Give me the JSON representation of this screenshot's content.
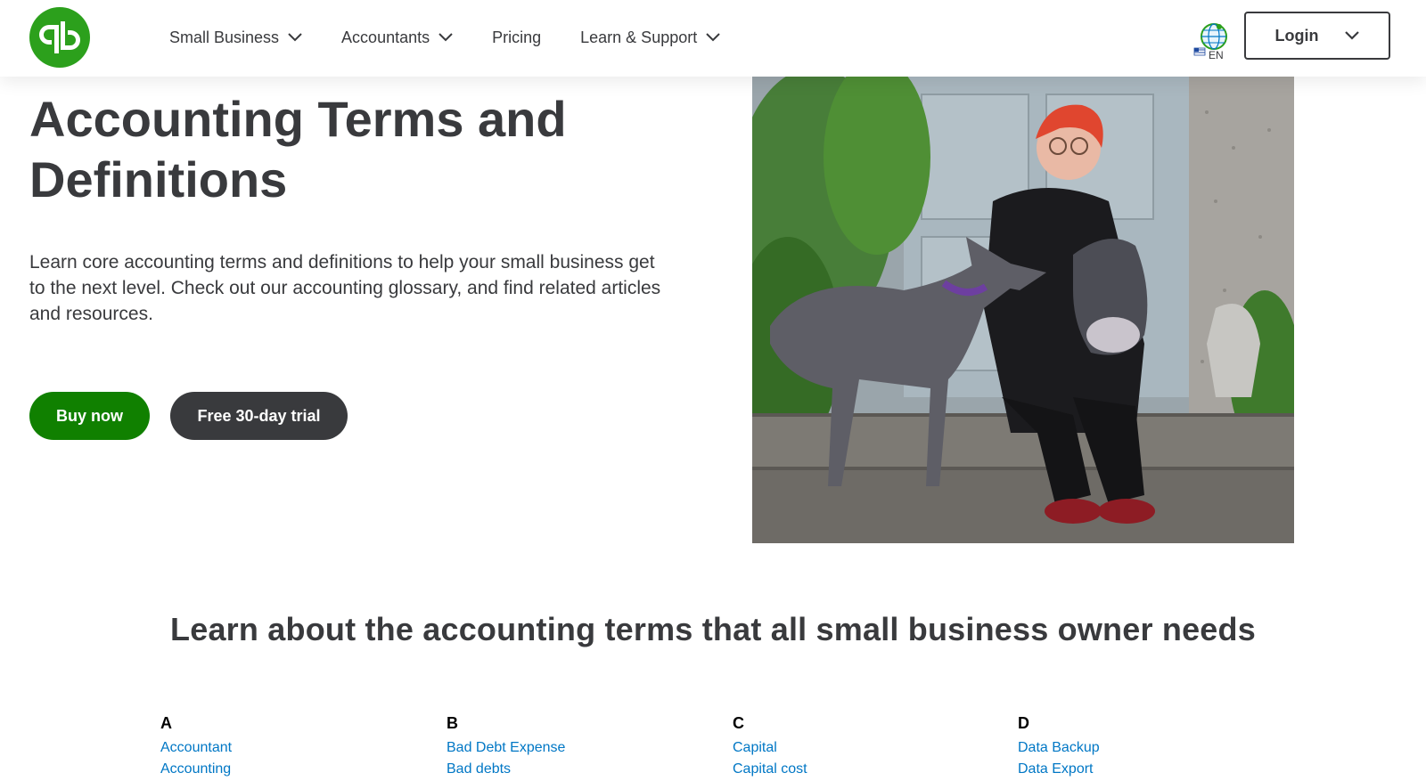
{
  "brand": {
    "logo_icon": "quickbooks-logo-icon",
    "color": "#2ca01c"
  },
  "nav": {
    "items": [
      {
        "label": "Small Business",
        "has_dropdown": true
      },
      {
        "label": "Accountants",
        "has_dropdown": true
      },
      {
        "label": "Pricing",
        "has_dropdown": false
      },
      {
        "label": "Learn & Support",
        "has_dropdown": true
      }
    ],
    "language_code": "EN",
    "language_icon": "globe-icon",
    "login_label": "Login"
  },
  "hero": {
    "title": "Accounting Terms and Definitions",
    "description": "Learn core accounting terms and definitions to help your small business get to the next level. Check out our accounting glossary, and find related articles and resources.",
    "buy_label": "Buy now",
    "trial_label": "Free 30-day trial"
  },
  "section": {
    "title": "Learn about the accounting terms that all small business owner needs",
    "columns": [
      {
        "letter": "A",
        "terms": [
          "Accountant",
          "Accounting"
        ]
      },
      {
        "letter": "B",
        "terms": [
          "Bad Debt Expense",
          "Bad debts"
        ]
      },
      {
        "letter": "C",
        "terms": [
          "Capital",
          "Capital cost"
        ]
      },
      {
        "letter": "D",
        "terms": [
          "Data Backup",
          "Data Export"
        ]
      }
    ]
  },
  "colors": {
    "accent_green": "#108000",
    "dark": "#393a3d",
    "link": "#0077c5"
  }
}
